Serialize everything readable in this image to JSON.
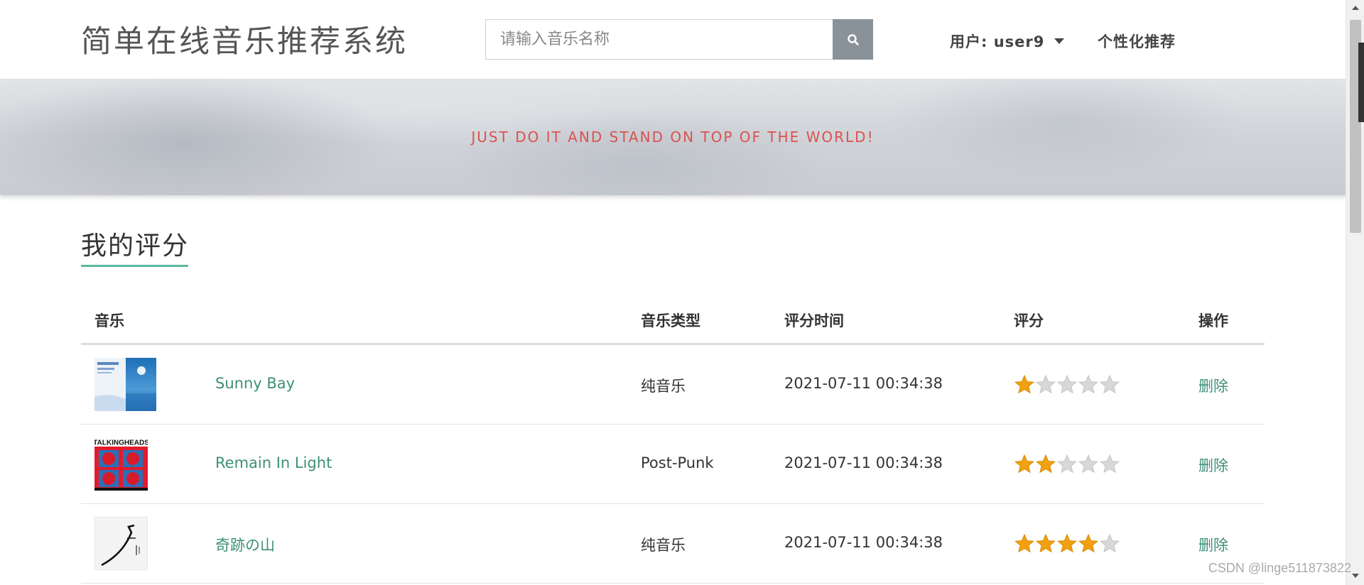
{
  "header": {
    "site_title": "简单在线音乐推荐系统",
    "search_placeholder": "请输入音乐名称",
    "search_icon": "search-icon",
    "user_label": "用户: user9",
    "recommend_label": "个性化推荐"
  },
  "banner": {
    "slogan": "JUST DO IT AND STAND ON TOP OF THE WORLD!"
  },
  "section": {
    "title": "我的评分"
  },
  "table": {
    "headers": {
      "music": "音乐",
      "genre": "音乐类型",
      "time": "评分时间",
      "rating": "评分",
      "action": "操作"
    },
    "rows": [
      {
        "title": "Sunny Bay",
        "genre": "纯音乐",
        "time": "2021-07-11 00:34:38",
        "rating": 1,
        "action": "删除"
      },
      {
        "title": "Remain In Light",
        "genre": "Post-Punk",
        "time": "2021-07-11 00:34:38",
        "rating": 2,
        "action": "删除",
        "cover_text": "TALKINGHEADS"
      },
      {
        "title": "奇跡の山",
        "genre": "纯音乐",
        "time": "2021-07-11 00:34:38",
        "rating": 4,
        "action": "删除"
      }
    ],
    "max_rating": 5
  },
  "watermark": "CSDN @linge511873822",
  "colors": {
    "accent": "#3e8f78",
    "underline": "#5cb8a0",
    "slogan": "#d9534f",
    "star_on": "#f0a010",
    "star_off": "#d8d8d8"
  }
}
